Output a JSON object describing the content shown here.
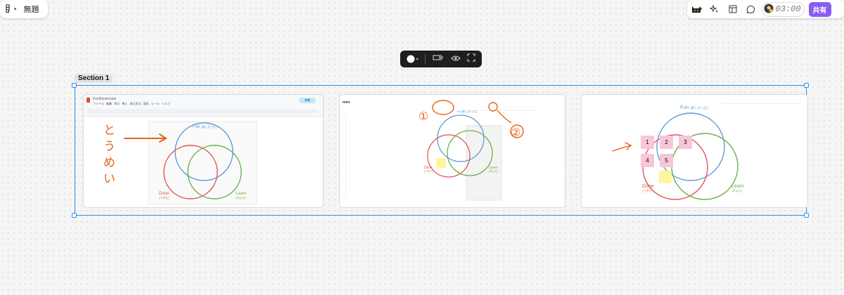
{
  "topbar": {
    "file_title": "無題",
    "share_label": "共有",
    "timer": "03:00",
    "icons": [
      "figma-logo-icon",
      "chevron-down-icon",
      "cat-avatar-icon",
      "chevron-down-icon",
      "ai-sparkle-icon",
      "layout-icon",
      "comment-icon",
      "user-avatar-icon"
    ]
  },
  "float_toolbar": {
    "icons": [
      "color-circle-icon",
      "chevron-down-icon",
      "resize-frame-icon",
      "eye-icon",
      "fullscreen-icon"
    ]
  },
  "section": {
    "label": "Section 1"
  },
  "cards": [
    {
      "doc_title": "FunDoneLearn",
      "menu": [
        "ファイル",
        "編集",
        "表示",
        "挿入",
        "表示形式",
        "図形",
        "ツール",
        "ヘルプ"
      ],
      "share": "共有",
      "handwriting": "とうめい",
      "venn": {
        "fun": "Fun",
        "fun_sub": "(楽しかった)",
        "done": "Done",
        "done_sub": "(できた)",
        "learn": "Learn",
        "learn_sub": "(学んだ)"
      }
    },
    {
      "app": "miro",
      "venn": {
        "fun_sub": "fun(楽しかった)",
        "done": "Done",
        "done_sub": "(できた)",
        "learn": "Learn",
        "learn_sub": "(学んだ)"
      },
      "annotations": [
        "①",
        "②"
      ]
    },
    {
      "venn": {
        "fun": "Fun",
        "fun_sub": "(楽しかった)",
        "done": "Done",
        "done_sub": "(できた)",
        "learn": "Learn",
        "learn_sub": "(学んだ)"
      },
      "stickies": [
        "1",
        "2",
        "3",
        "4",
        "5"
      ]
    }
  ]
}
